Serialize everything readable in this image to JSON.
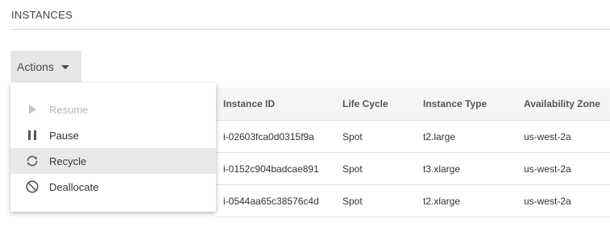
{
  "section": {
    "title": "INSTANCES"
  },
  "actions": {
    "label": "Actions",
    "menu": [
      {
        "label": "Resume",
        "icon": "play-icon",
        "disabled": true
      },
      {
        "label": "Pause",
        "icon": "pause-icon"
      },
      {
        "label": "Recycle",
        "icon": "recycle-icon",
        "highlighted": true
      },
      {
        "label": "Deallocate",
        "icon": "block-icon"
      }
    ]
  },
  "table": {
    "headers": [
      "Instance ID",
      "Life Cycle",
      "Instance Type",
      "Availability Zone"
    ],
    "rows": [
      [
        "i-02603fca0d0315f9a",
        "Spot",
        "t2.large",
        "us-west-2a"
      ],
      [
        "i-0152c904badcae891",
        "Spot",
        "t3.xlarge",
        "us-west-2a"
      ],
      [
        "i-0544aa65c38576c4d",
        "Spot",
        "t2.xlarge",
        "us-west-2a"
      ]
    ]
  }
}
